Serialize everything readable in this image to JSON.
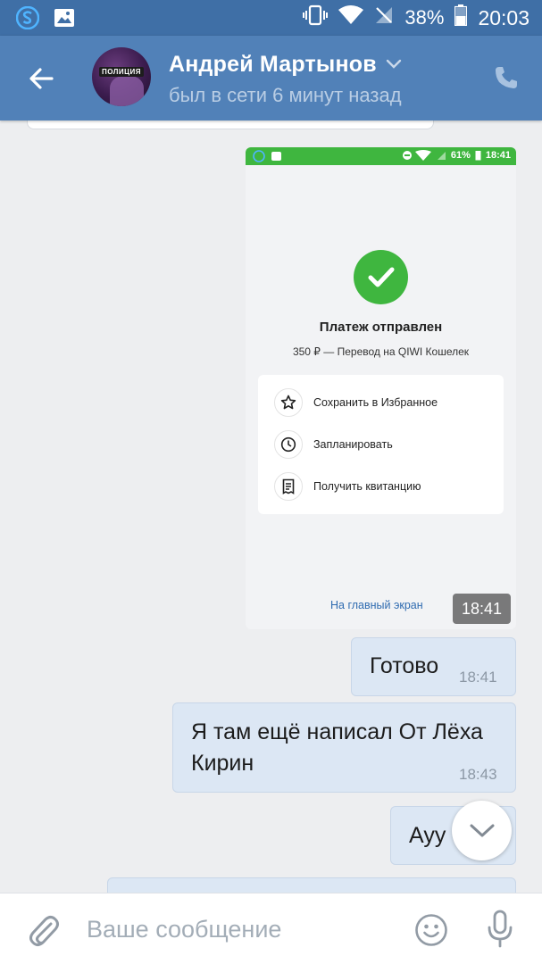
{
  "status_bar": {
    "battery": "38%",
    "time": "20:03"
  },
  "header": {
    "contact_name": "Андрей Мартынов",
    "contact_status": "был в сети 6 минут назад",
    "avatar_caption": "ПОЛИЦИЯ"
  },
  "messages": {
    "screenshot": {
      "status_battery": "61%",
      "status_time": "18:41",
      "title": "Платеж отправлен",
      "subtitle": "350 ₽ — Перевод на QIWI Кошелек",
      "actions": [
        {
          "label": "Сохранить в Избранное",
          "icon": "star-icon"
        },
        {
          "label": "Запланировать",
          "icon": "clock-icon"
        },
        {
          "label": "Получить квитанцию",
          "icon": "receipt-icon"
        }
      ],
      "home_link": "На главный экран",
      "time": "18:41"
    },
    "items": [
      {
        "text": "Готово",
        "time": "18:41"
      },
      {
        "text": "Я там ещё написал От Лёха Кирин",
        "time": "18:43"
      },
      {
        "text": "Ауу",
        "time": ""
      }
    ]
  },
  "composer": {
    "placeholder": "Ваше сообщение"
  },
  "colors": {
    "status_bar": "#3f6fa6",
    "header": "#5181b8",
    "bubble": "#dce7f4",
    "qiwi_green": "#3fb63f"
  }
}
